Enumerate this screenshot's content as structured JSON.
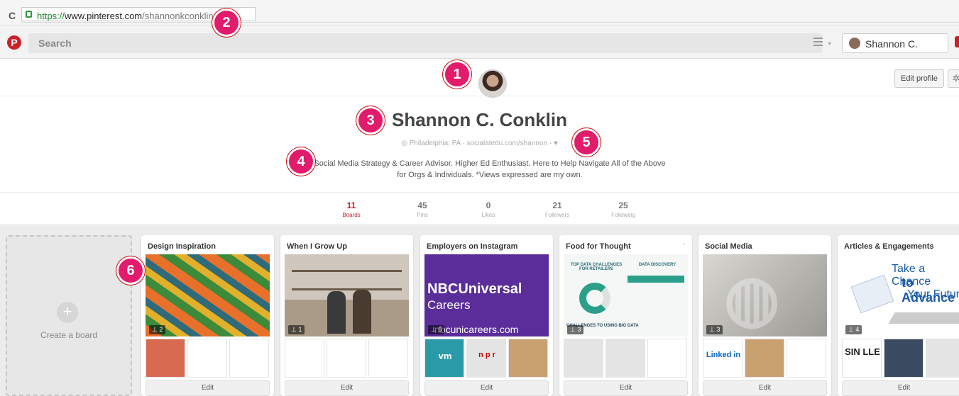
{
  "browser": {
    "url_scheme": "https://",
    "url_host": "www.pinterest.com",
    "url_path": "/shannonkconklin"
  },
  "header": {
    "logo": "P",
    "search_placeholder": "Search",
    "user_name": "Shannon C."
  },
  "profile": {
    "edit_label": "Edit profile",
    "name": "Shannon C. Conklin",
    "location": "Philadelphia, PA",
    "website": "socialatedu.com/shannon",
    "bio": "Social Media Strategy & Career Advisor. Higher Ed Enthusiast. Here to Help Navigate All of the Above for Orgs & Individuals. *Views expressed are my own."
  },
  "stats": [
    {
      "num": "11",
      "label": "Boards",
      "active": true
    },
    {
      "num": "45",
      "label": "Pins"
    },
    {
      "num": "0",
      "label": "Likes"
    },
    {
      "num": "21",
      "label": "Followers"
    },
    {
      "num": "25",
      "label": "Following"
    }
  ],
  "create_board_label": "Create a board",
  "boards": [
    {
      "title": "Design Inspiration",
      "pins": "2",
      "edit": "Edit"
    },
    {
      "title": "When I Grow Up",
      "pins": "1",
      "edit": "Edit"
    },
    {
      "title": "Employers on Instagram",
      "pins": "5",
      "edit": "Edit",
      "cover_l1": "NBCUniversal",
      "cover_l2": "Careers",
      "cover_l3": "nbcunicareers.com",
      "thumb1": "vm",
      "thumb2": "n p r"
    },
    {
      "title": "Food for Thought",
      "pins": "3",
      "edit": "Edit",
      "cover_t1": "TOP DATA CHALLENGES FOR RETAILERS",
      "cover_t2": "DATA DISCOVERY",
      "cover_t3": "CHALLENGES TO USING BIG DATA"
    },
    {
      "title": "Social Media",
      "pins": "3",
      "edit": "Edit",
      "thumb0": "Linked in"
    },
    {
      "title": "Articles & Engagements",
      "pins": "4",
      "edit": "Edit",
      "cover_l1": "Take a Chance",
      "cover_l2": "to Advance",
      "cover_l3": "Your Future",
      "thumb0": "SIN LLE"
    }
  ],
  "annotations": [
    "1",
    "2",
    "3",
    "4",
    "5",
    "6"
  ],
  "colors": {
    "brand": "#cb2027",
    "badge": "#e21b6b"
  }
}
